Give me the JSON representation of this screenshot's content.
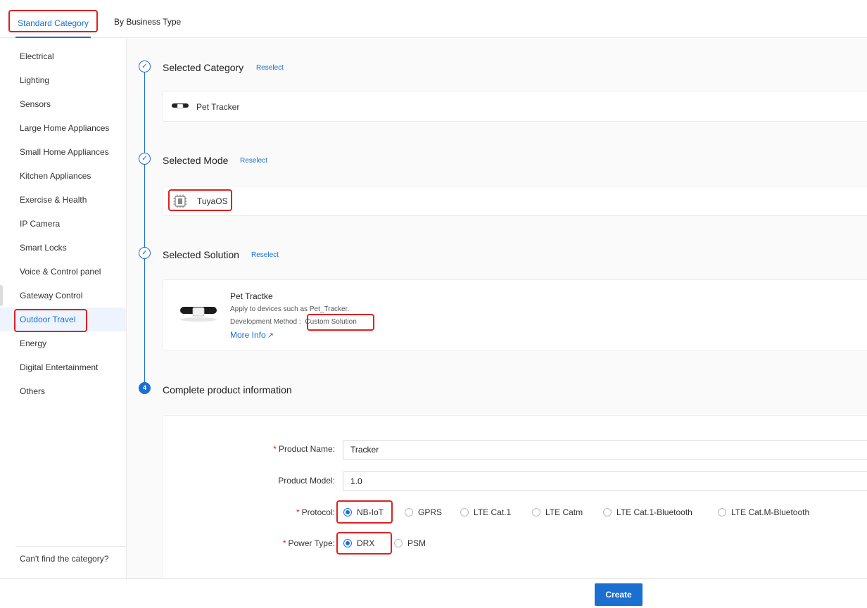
{
  "tabs": {
    "standard": "Standard Category",
    "business": "By Business Type"
  },
  "sidebar": {
    "items": [
      {
        "label": "Electrical"
      },
      {
        "label": "Lighting"
      },
      {
        "label": "Sensors"
      },
      {
        "label": "Large Home Appliances"
      },
      {
        "label": "Small Home Appliances"
      },
      {
        "label": "Kitchen Appliances"
      },
      {
        "label": "Exercise & Health"
      },
      {
        "label": "IP Camera"
      },
      {
        "label": "Smart Locks"
      },
      {
        "label": "Voice & Control panel"
      },
      {
        "label": "Gateway Control"
      },
      {
        "label": "Outdoor Travel"
      },
      {
        "label": "Energy"
      },
      {
        "label": "Digital Entertainment"
      },
      {
        "label": "Others"
      }
    ],
    "active": "Outdoor Travel",
    "footer": "Can't find the category?"
  },
  "steps": {
    "category": {
      "title": "Selected Category",
      "reselect": "Reselect",
      "value": "Pet Tracker"
    },
    "mode": {
      "title": "Selected Mode",
      "reselect": "Reselect",
      "value": "TuyaOS"
    },
    "solution": {
      "title": "Selected Solution",
      "reselect": "Reselect",
      "name": "Pet Tractke",
      "desc": "Apply to devices such as Pet_Tracker.",
      "dev_label": "Development Method :",
      "dev_value": "Custom Solution",
      "more": "More Info"
    },
    "complete": {
      "number": "4",
      "title": "Complete product information"
    }
  },
  "form": {
    "product_name": {
      "label": "Product Name",
      "value": "Tracker"
    },
    "product_model": {
      "label": "Product Model",
      "value": "1.0"
    },
    "protocol": {
      "label": "Protocol",
      "options": [
        "NB-IoT",
        "GPRS",
        "LTE Cat.1",
        "LTE Catm",
        "LTE Cat.1-Bluetooth",
        "LTE Cat.M-Bluetooth"
      ],
      "selected": "NB-IoT"
    },
    "power_type": {
      "label": "Power Type",
      "options": [
        "DRX",
        "PSM"
      ],
      "selected": "DRX"
    },
    "colon": ":"
  },
  "actions": {
    "create": "Create"
  },
  "colors": {
    "accent": "#1a6fd1",
    "highlight": "#e02020"
  }
}
